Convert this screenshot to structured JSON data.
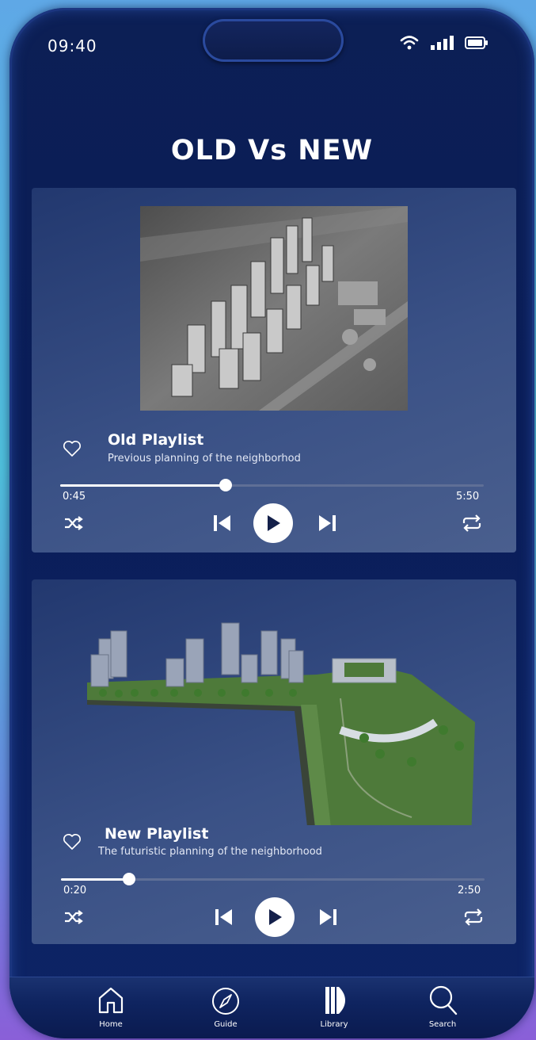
{
  "status": {
    "time": "09:40"
  },
  "page": {
    "title": "OLD Vs NEW"
  },
  "old_playlist": {
    "title": "Old Playlist",
    "subtitle": "Previous planning of the neighborhod",
    "elapsed": "0:45",
    "duration": "5:50",
    "progress": 0.39
  },
  "new_playlist": {
    "title": "New Playlist",
    "subtitle": "The futuristic planning of the neighborhood",
    "elapsed": "0:20",
    "duration": "2:50",
    "progress": 0.16
  },
  "nav": [
    {
      "label": "Home",
      "icon": "home-icon"
    },
    {
      "label": "Guide",
      "icon": "compass-icon"
    },
    {
      "label": "Library",
      "icon": "library-icon"
    },
    {
      "label": "Search",
      "icon": "search-icon"
    }
  ],
  "colors": {
    "background": "#0c1f55",
    "card": "#2f4580",
    "accent": "#ffffff"
  }
}
